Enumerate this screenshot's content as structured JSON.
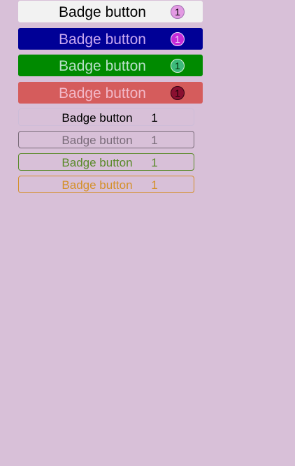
{
  "buttons": [
    {
      "label": "Badge button",
      "badge": "1",
      "style": "filled",
      "background": "#f2f2f2",
      "text_color": "#000000",
      "badge_color": "#e39ae3"
    },
    {
      "label": "Badge button",
      "badge": "1",
      "style": "filled",
      "background": "#000096",
      "text_color": "#c8a8f0",
      "badge_color": "#c42ad8"
    },
    {
      "label": "Badge button",
      "badge": "1",
      "style": "filled",
      "background": "#008a00",
      "text_color": "#b8e0c8",
      "badge_color": "#3cba7a"
    },
    {
      "label": "Badge button",
      "badge": "1",
      "style": "filled",
      "background": "#d55c5c",
      "text_color": "#f2b8c8",
      "badge_color": "#8a1030"
    },
    {
      "label": "Badge button",
      "badge": "1",
      "style": "outlined",
      "text_color": "#000000",
      "border_color": "#cdbdd8"
    },
    {
      "label": "Badge button",
      "badge": "1",
      "style": "outlined",
      "text_color": "#7a6c7a",
      "border_color": "#7a6c7a"
    },
    {
      "label": "Badge button",
      "badge": "1",
      "style": "outlined",
      "text_color": "#5a8a2a",
      "border_color": "#5a8a2a"
    },
    {
      "label": "Badge button",
      "badge": "1",
      "style": "outlined",
      "text_color": "#d4902a",
      "border_color": "#d4902a"
    }
  ],
  "page_background": "#d8c0d8"
}
